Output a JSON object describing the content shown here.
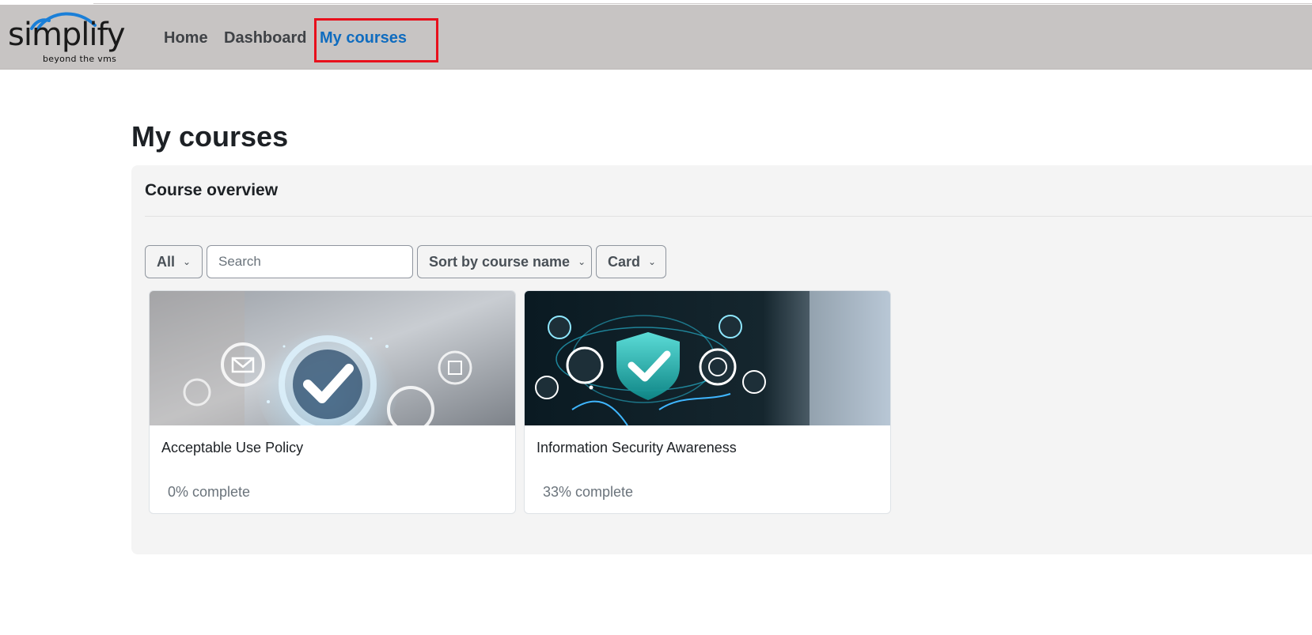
{
  "brand": {
    "name": "simplify",
    "tagline": "beyond the vms",
    "arc_color": "#1a7fd8"
  },
  "nav": {
    "items": [
      {
        "label": "Home"
      },
      {
        "label": "Dashboard"
      },
      {
        "label": "My courses",
        "active": true
      }
    ],
    "active_color": "#0f6cbf",
    "highlight_color": "#e8101c"
  },
  "page": {
    "title": "My courses"
  },
  "course_overview": {
    "title": "Course overview",
    "filter": {
      "selected": "All",
      "icon": "chevron-down-icon"
    },
    "search": {
      "placeholder": "Search",
      "value": ""
    },
    "sort": {
      "selected": "Sort by course name",
      "icon": "chevron-down-icon"
    },
    "view": {
      "selected": "Card",
      "icon": "chevron-down-icon"
    },
    "courses": [
      {
        "name": "Acceptable Use Policy",
        "progress_text": "0% complete",
        "progress_percent": 0
      },
      {
        "name": "Information Security Awareness",
        "progress_text": "33% complete",
        "progress_percent": 33
      }
    ]
  }
}
